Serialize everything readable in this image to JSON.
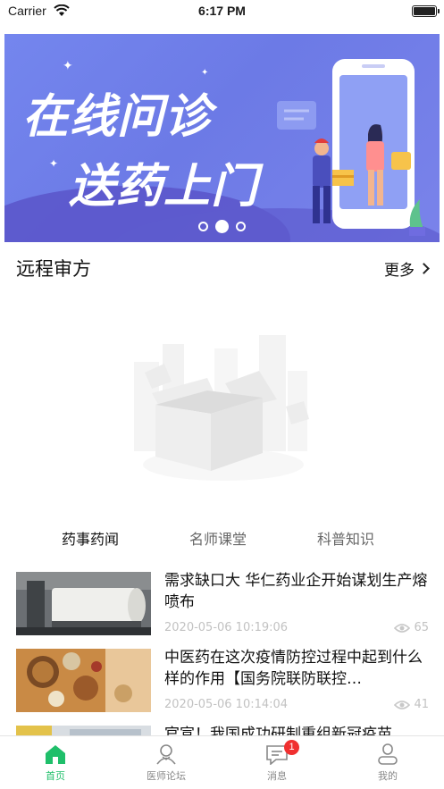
{
  "status_bar": {
    "carrier": "Carrier",
    "time": "6:17 PM"
  },
  "banner": {
    "line1": "在线问诊",
    "line2": "送药上门",
    "slide_count": 3,
    "active_slide": 2,
    "colors": {
      "background": "#7486ee",
      "wave": "#5a55c9"
    }
  },
  "section": {
    "title": "远程审方",
    "more_label": "更多"
  },
  "tabs": [
    {
      "label": "药事药闻",
      "active": true
    },
    {
      "label": "名师课堂",
      "active": false
    },
    {
      "label": "科普知识",
      "active": false
    }
  ],
  "news": [
    {
      "title": "需求缺口大 华仁药业企开始谋划生产熔喷布",
      "date": "2020-05-06 10:19:06",
      "views": "65",
      "thumb": "factory-machine"
    },
    {
      "title": "中医药在这次疫情防控过程中起到什么样的作用【国务院联防联控…",
      "date": "2020-05-06 10:14:04",
      "views": "41",
      "thumb": "herbal-medicine"
    },
    {
      "title": "官宣！我国成功研制重组新冠疫苗",
      "date": "",
      "views": "",
      "thumb": "lab"
    }
  ],
  "tab_bar": [
    {
      "label": "首页",
      "icon": "home-icon",
      "active": true
    },
    {
      "label": "医师论坛",
      "icon": "doctor-icon",
      "active": false
    },
    {
      "label": "消息",
      "icon": "message-icon",
      "active": false,
      "badge": "1"
    },
    {
      "label": "我的",
      "icon": "profile-icon",
      "active": false
    }
  ],
  "colors": {
    "accent": "#1fbf6a",
    "badge": "#f03030",
    "tab_highlight": "#f5e11c"
  }
}
